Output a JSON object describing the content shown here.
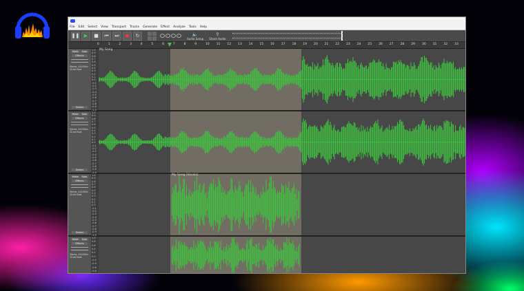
{
  "logo": {
    "icon": "audacity-logo-icon"
  },
  "window": {
    "menu": [
      "File",
      "Edit",
      "Select",
      "View",
      "Transport",
      "Tracks",
      "Generate",
      "Effect",
      "Analyze",
      "Tools",
      "Help"
    ],
    "toolbar": {
      "pause": "❚❚",
      "play": "▶",
      "stop": "■",
      "skip_start": "⏮",
      "skip_end": "⏭",
      "record": "●",
      "loop": "↻",
      "audio_setup_label": "Audio Setup",
      "share_audio_label": "Share Audio",
      "meter_ticks": "-48 -42 -36 -30 -24 -18 -12 -6 0"
    },
    "ruler_ticks": [
      "0",
      "1",
      "2",
      "3",
      "4",
      "5",
      "6",
      "7",
      "8",
      "9",
      "10",
      "11",
      "12",
      "13",
      "14",
      "15",
      "16",
      "17",
      "18",
      "19",
      "20",
      "21",
      "22",
      "23",
      "24",
      "25",
      "26",
      "27",
      "28",
      "29",
      "30",
      "31",
      "32",
      "33",
      "34"
    ],
    "tracks": [
      {
        "clip_name": "My Song",
        "mute": "Mute",
        "solo": "Solo",
        "effects": "Effects",
        "info": "Stereo, 44100Hz\n32-bit float",
        "select": "Select"
      },
      {
        "clip_name": "",
        "mute": "Mute",
        "solo": "Solo",
        "effects": "Effects",
        "info": "Stereo, 44100Hz\n32-bit float",
        "select": "Select"
      },
      {
        "clip_name": "My Song (Vocals)",
        "mute": "Mute",
        "solo": "Solo",
        "effects": "Effects",
        "info": "Stereo, 44100Hz\n32-bit float",
        "select": "Select"
      },
      {
        "clip_name": "",
        "mute": "Mute",
        "solo": "Solo",
        "effects": "Effects",
        "info": "Stereo, 44100Hz\n32-bit float",
        "select": ""
      }
    ],
    "scale_labels": [
      "1.0",
      "0.9",
      "0.8",
      "0.7",
      "0.6",
      "0.5",
      "0.4",
      "0.3",
      "0.2",
      "0.1",
      "0.0",
      "-0.1",
      "-0.2",
      "-0.3",
      "-0.4",
      "-0.5",
      "-0.6",
      "-0.7",
      "-0.8",
      "-0.9",
      "-1.0"
    ]
  },
  "colors": {
    "waveform": "#3fbf3f",
    "selection": "#7a7467",
    "track_bg": "#474747"
  }
}
